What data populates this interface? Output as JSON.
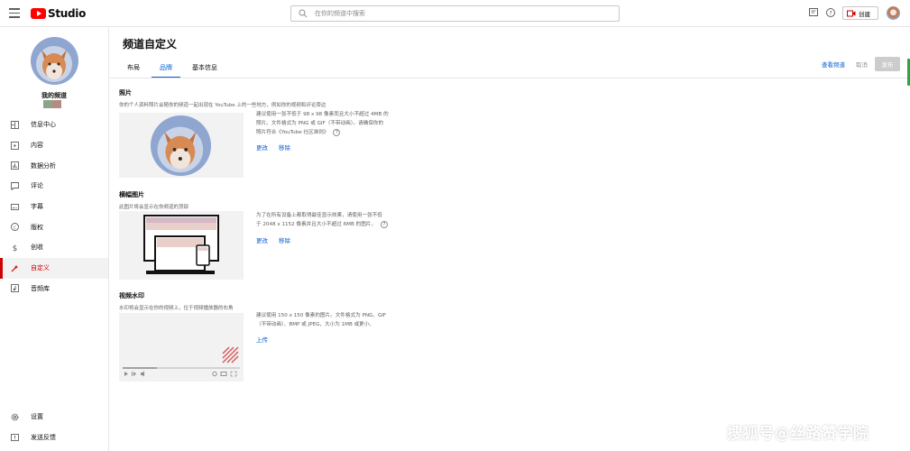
{
  "app": {
    "logo_text": "Studio"
  },
  "search": {
    "placeholder": "在你的频道中搜索"
  },
  "header": {
    "create_label": "创建"
  },
  "sidebar": {
    "channel_label": "我的频道",
    "items": [
      {
        "label": "信息中心",
        "icon": "dashboard-icon"
      },
      {
        "label": "内容",
        "icon": "content-icon"
      },
      {
        "label": "数据分析",
        "icon": "analytics-icon"
      },
      {
        "label": "评论",
        "icon": "comments-icon"
      },
      {
        "label": "字幕",
        "icon": "subtitles-icon"
      },
      {
        "label": "版权",
        "icon": "copyright-icon"
      },
      {
        "label": "创收",
        "icon": "monetization-icon"
      },
      {
        "label": "自定义",
        "icon": "customization-icon",
        "active": true
      },
      {
        "label": "音频库",
        "icon": "audio-library-icon"
      }
    ],
    "bottom_items": [
      {
        "label": "设置",
        "icon": "settings-icon"
      },
      {
        "label": "发送反馈",
        "icon": "feedback-icon"
      }
    ]
  },
  "main": {
    "title": "频道自定义",
    "tabs": [
      {
        "label": "布局",
        "active": false
      },
      {
        "label": "品牌",
        "active": true
      },
      {
        "label": "基本信息",
        "active": false
      }
    ],
    "actions": {
      "view_channel": "查看频道",
      "cancel": "取消",
      "publish": "发布"
    },
    "sections": {
      "photo": {
        "title": "照片",
        "desc": "你的个人资料照片会随你的频道一起出现在 YouTube 上的一些地方，例如你的视频和评论旁边",
        "info": [
          "建议使用一张不低于 98 x 98 像素而且大小不超过 4MB 的",
          "照片。文件格式为 PNG 或 GIF（不带动画）。请确保你的",
          "照片符合《YouTube 社区准则》"
        ],
        "change": "更改",
        "remove": "移除"
      },
      "banner": {
        "title": "横幅图片",
        "desc": "此图片将会显示在你频道的顶部",
        "info": [
          "为了在所有设备上都取得最佳显示效果，请使用一张不低",
          "于 2048 x 1152 像素并且大小不超过 6MB 的图片。"
        ],
        "change": "更改",
        "remove": "移除"
      },
      "watermark": {
        "title": "视频水印",
        "desc": "水印将会显示在你的视频上，位于视频播放器的右角",
        "info": [
          "建议使用 150 x 150 像素的图片。文件格式为 PNG、GIF",
          "（不带动画）、BMP 或 JPEG，大小为 1MB 或更小。"
        ],
        "upload": "上传"
      }
    }
  },
  "overlay": {
    "brand_watermark": "搜狐号@丝路赞学院"
  },
  "colors": {
    "accent": "#065fd4",
    "active": "#cc0000",
    "youtube_red": "#ff0000",
    "publish_disabled": "#cccccc"
  }
}
